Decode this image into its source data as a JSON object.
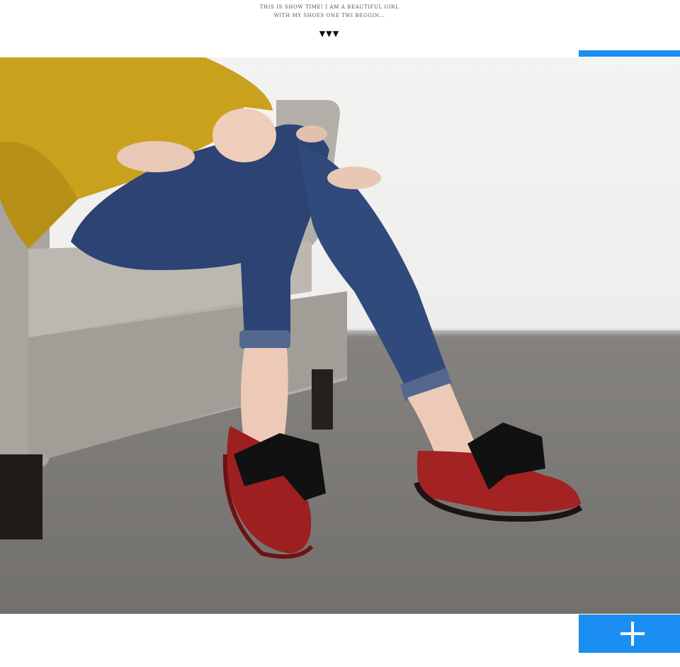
{
  "header": {
    "caption_line1": "THIS IS SHOW TIME! I AM A BEAUTIFUL GIRL",
    "caption_line2": "WITH MY SHOES ONE TWI BEGGIN...",
    "arrows": "▼▼▼"
  },
  "accent_color": "#1b8ef2",
  "icons": {
    "plus": "plus-icon"
  }
}
